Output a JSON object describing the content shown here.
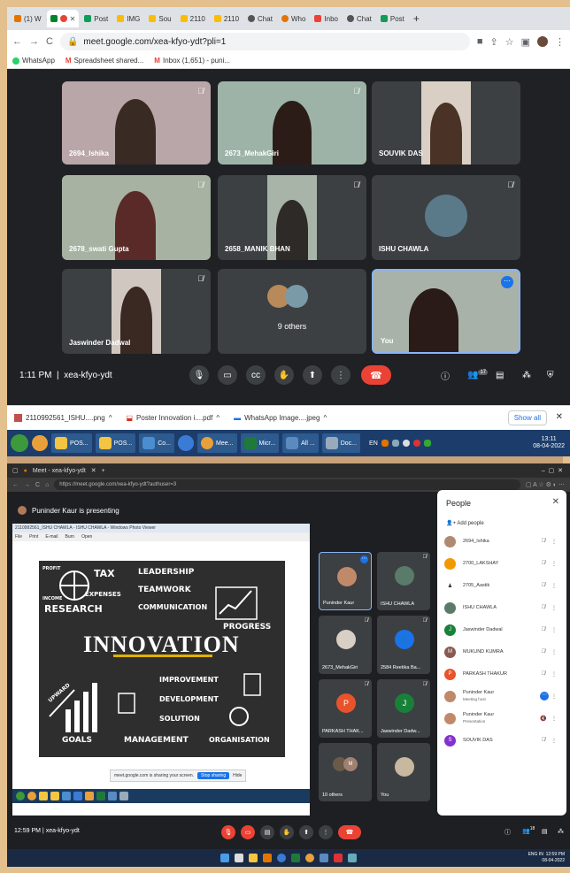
{
  "shot1": {
    "tabs": [
      "(1) W",
      "",
      "Post",
      "IMG",
      "Sou",
      "2110",
      "2110",
      "Chat",
      "Who",
      "Inbo",
      "Chat",
      "Post"
    ],
    "url": "meet.google.com/xea-kfyo-ydt?pli=1",
    "bookmarks": [
      "WhatsApp",
      "Spreadsheet shared...",
      "Inbox (1,651) - puni..."
    ],
    "tiles": [
      "2694_Ishika",
      "2673_MehakGiri",
      "SOUVIK DAS",
      "2678_swati Gupta",
      "2658_MANIK BHAN",
      "ISHU CHAWLA",
      "Jaswinder Dadwal",
      "9 others",
      "You"
    ],
    "time": "1:11 PM",
    "meeting_code": "xea-kfyo-ydt",
    "people_count": "17",
    "downloads": [
      "2110992561_ISHU....png",
      "Poster Innovation i....pdf",
      "WhatsApp Image....jpeg"
    ],
    "show_all": "Show all",
    "taskbar": [
      "POS...",
      "POS...",
      "Co...",
      "Mee...",
      "Micr...",
      "All ...",
      "Doc..."
    ],
    "tray_lang": "EN",
    "clock_time": "13:11",
    "clock_date": "08-04-2022"
  },
  "shot2": {
    "tab": "Meet - xea-kfyo-ydt",
    "url": "https://meet.google.com/xea-kfyo-ydt?authuser=3",
    "presenting": "Puninder Kaur is presenting",
    "viewer_title": "2110992561_ISHU CHAWLA - ISHU CHAWLA - Windows Photo Viewer",
    "viewer_menu": [
      "File",
      "Print",
      "E-mail",
      "Burn",
      "Open"
    ],
    "poster": {
      "tax": "TAX",
      "profit": "PROFIT",
      "expenses": "EXPENSES",
      "income": "INCOME",
      "research": "RESEARCH",
      "leadership": "LEADERSHIP",
      "teamwork": "TEAMWORK",
      "communication": "COMMUNICATION",
      "progress": "PROGRESS",
      "innovation": "INNOVATION",
      "upward": "UPWARD",
      "improvement": "IMPROVEMENT",
      "development": "DEVELOPMENT",
      "solution": "SOLUTION",
      "goals": "GOALS",
      "management": "MANAGEMENT",
      "organisation": "ORGANISATION"
    },
    "share_text": "meet.google.com is sharing your screen.",
    "stop_sharing": "Stop sharing",
    "hide": "Hide",
    "grid": [
      "Puninder Kaur",
      "ISHU CHAWLA",
      "2673_MehakGiri",
      "2584 Reetika Ba...",
      "PARKASH THAK...",
      "Jaswinder Dadw...",
      "10 others",
      "You"
    ],
    "people_title": "People",
    "add_people": "Add people",
    "people": [
      {
        "name": "2694_Ishika",
        "sub": ""
      },
      {
        "name": "2700_LAKSHAY",
        "sub": ""
      },
      {
        "name": "2705_Aastik",
        "sub": ""
      },
      {
        "name": "ISHU CHAWLA",
        "sub": ""
      },
      {
        "name": "Jaswinder Dadwal",
        "sub": ""
      },
      {
        "name": "MUKUND KUMRA",
        "sub": ""
      },
      {
        "name": "PARKASH THAKUR",
        "sub": ""
      },
      {
        "name": "Puninder Kaur",
        "sub": "Meeting host"
      },
      {
        "name": "Puninder Kaur",
        "sub": "Presentation"
      },
      {
        "name": "SOUVIK DAS",
        "sub": ""
      }
    ],
    "time": "12:59 PM",
    "meeting_code": "xea-kfyo-ydt",
    "people_count": "18",
    "clock_time": "12:59 PM",
    "clock_date": "08-04-2022",
    "tray_lang": "ENG IN"
  }
}
